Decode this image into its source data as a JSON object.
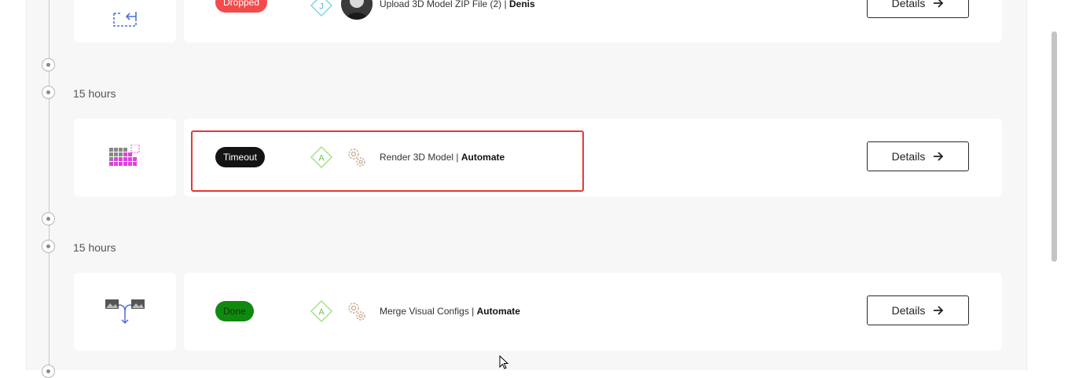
{
  "rows": [
    {
      "status": "Dropped",
      "actor_letter": "J",
      "task_name": "Upload 3D Model ZIP File (2)",
      "separator": " | ",
      "assignee": "Denis",
      "details_label": "Details"
    },
    {
      "time": "15 hours",
      "status": "Timeout",
      "actor_letter": "A",
      "task_name": "Render 3D Model",
      "separator": " | ",
      "assignee": "Automate",
      "details_label": "Details"
    },
    {
      "time": "15 hours",
      "status": "Done",
      "actor_letter": "A",
      "task_name": "Merge Visual Configs",
      "separator": " | ",
      "assignee": "Automate",
      "details_label": "Details"
    }
  ],
  "colors": {
    "dropped": "#f24b4b",
    "timeout": "#141414",
    "done": "#0f8a0f",
    "highlight": "#e53935"
  },
  "icons": {
    "row0": "upload-file-icon",
    "row1": "render-grid-icon",
    "row2": "merge-images-icon",
    "agent": "gears-icon",
    "arrow": "arrow-right-icon"
  }
}
